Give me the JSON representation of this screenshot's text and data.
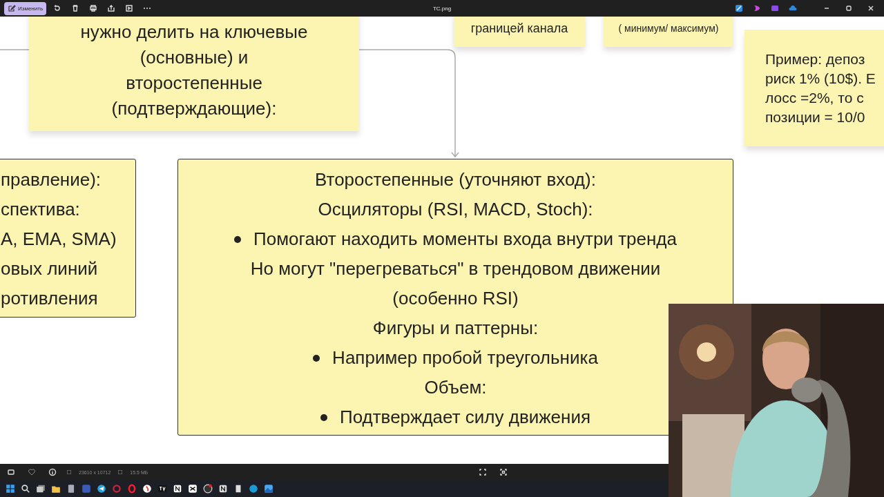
{
  "toolbar": {
    "edit_button": "Изменить",
    "title": "TC.png"
  },
  "canvas": {
    "cards": [
      {
        "kind": "sticky",
        "lines": [
          "нужно делить на ключевые",
          "(основные) и",
          "второстепенные",
          "(подтверждающие):"
        ]
      },
      {
        "kind": "sticky",
        "lines": [
          "границей канала"
        ]
      },
      {
        "kind": "sticky",
        "lines": [
          "( минимум/ максимум)"
        ]
      },
      {
        "kind": "sticky",
        "lines": [
          "Пример: депоз",
          "риск 1% (10$). Е",
          "лосс =2%, то с",
          "позиции = 10/0"
        ]
      },
      {
        "kind": "outlined",
        "lines": [
          "правление):",
          "спектива:",
          "А, EMA, SMA)",
          "овых линий",
          "ротивления"
        ]
      },
      {
        "kind": "outlined",
        "items": [
          {
            "kind": "heading",
            "text": "Второстепенные (уточняют вход):"
          },
          {
            "kind": "heading",
            "text": "Осциляторы (RSI, MACD, Stoch):"
          },
          {
            "kind": "bullet",
            "text": "Помогают находить моменты входа внутри тренда"
          },
          {
            "kind": "heading",
            "text": "Но могут \"перегреваться\" в трендовом движении (особенно RSI)"
          },
          {
            "kind": "heading",
            "text": "Фигуры и паттерны:"
          },
          {
            "kind": "bullet",
            "text": "Например пробой треугольника"
          },
          {
            "kind": "heading",
            "text": "Объем:"
          },
          {
            "kind": "bullet",
            "text": "Подтверждает силу движения"
          }
        ]
      }
    ]
  },
  "info_bar": {
    "dimensions": "23610 x 10712",
    "size": "15.5 МБ"
  }
}
